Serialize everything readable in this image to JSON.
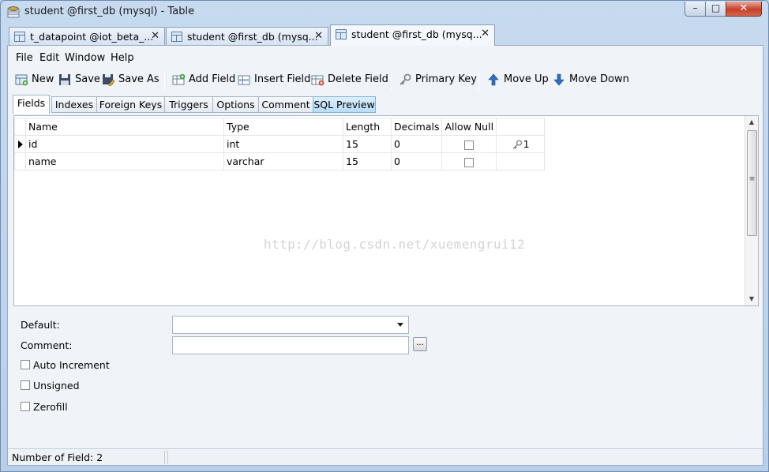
{
  "window": {
    "title": "student @first_db (mysql) - Table",
    "min": "–",
    "max": "□",
    "close": "✕"
  },
  "doc_tabs": [
    {
      "label": "t_datapoint @iot_beta_..."
    },
    {
      "label": "student @first_db (mysq..."
    },
    {
      "label": "student @first_db (mysq..."
    }
  ],
  "doc_tab_close": "✕",
  "menu": [
    "File",
    "Edit",
    "Window",
    "Help"
  ],
  "toolbar": {
    "new": "New",
    "save": "Save",
    "save_as": "Save As",
    "add_field": "Add Field",
    "insert_field": "Insert Field",
    "delete_field": "Delete Field",
    "primary_key": "Primary Key",
    "move_up": "Move Up",
    "move_down": "Move Down"
  },
  "sub_tabs": [
    "Fields",
    "Indexes",
    "Foreign Keys",
    "Triggers",
    "Options",
    "Comment",
    "SQL Preview"
  ],
  "grid": {
    "columns": [
      "Name",
      "Type",
      "Length",
      "Decimals",
      "Allow Null"
    ],
    "rows": [
      {
        "name": "id",
        "type": "int",
        "length": "15",
        "decimals": "0",
        "allow_null": false,
        "key": "1"
      },
      {
        "name": "name",
        "type": "varchar",
        "length": "15",
        "decimals": "0",
        "allow_null": false,
        "key": ""
      }
    ]
  },
  "watermark": "http://blog.csdn.net/xuemengrui12",
  "properties": {
    "default_label": "Default:",
    "default_value": "",
    "comment_label": "Comment:",
    "comment_value": "",
    "ellipsis": "...",
    "auto_increment": "Auto Increment",
    "unsigned": "Unsigned",
    "zerofill": "Zerofill"
  },
  "status": {
    "text": "Number of Field: 2"
  },
  "colors": {
    "accent": "#7fb3de",
    "chrome": "#b9d1ea"
  }
}
